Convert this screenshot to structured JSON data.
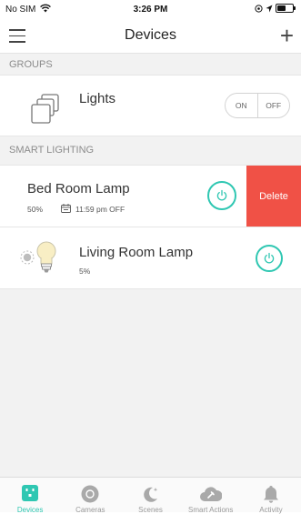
{
  "status_bar": {
    "carrier": "No SIM",
    "time": "3:26 PM"
  },
  "nav": {
    "title": "Devices"
  },
  "sections": {
    "groups": "GROUPS",
    "smart_lighting": "SMART LIGHTING"
  },
  "group": {
    "name": "Lights",
    "on_label": "ON",
    "off_label": "OFF"
  },
  "devices": [
    {
      "name": "Bed Room Lamp",
      "brightness": "50%",
      "schedule": "11:59 pm OFF"
    },
    {
      "name": "Living Room Lamp",
      "brightness": "5%"
    }
  ],
  "delete_label": "Delete",
  "tabs": [
    {
      "label": "Devices",
      "icon": "devices-icon",
      "active": true
    },
    {
      "label": "Cameras",
      "icon": "camera-icon"
    },
    {
      "label": "Scenes",
      "icon": "scenes-moon-icon"
    },
    {
      "label": "Smart Actions",
      "icon": "smart-actions-icon"
    },
    {
      "label": "Activity",
      "icon": "bell-icon"
    }
  ],
  "colors": {
    "accent": "#2fc7b2",
    "delete": "#f05146",
    "section_bg": "#f2f2f2"
  }
}
